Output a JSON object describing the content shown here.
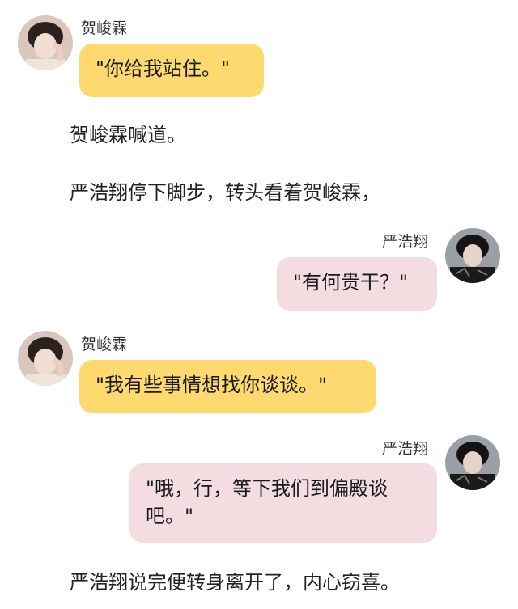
{
  "messages": [
    {
      "speaker": "贺峻霖",
      "text": "\"你给我站住。\""
    },
    {
      "speaker": "严浩翔",
      "text": "\"有何贵干？\""
    },
    {
      "speaker": "贺峻霖",
      "text": "\"我有些事情想找你谈谈。\""
    },
    {
      "speaker": "严浩翔",
      "text": "\"哦，行，等下我们到偏殿谈吧。\""
    }
  ],
  "narration": [
    "贺峻霖喊道。",
    "严浩翔停下脚步，转头看着贺峻霖，",
    "严浩翔说完便转身离开了，内心窃喜。"
  ],
  "colors": {
    "left_bubble": "#fdd96f",
    "right_bubble": "#f3dde0"
  },
  "icons": {
    "left_avatar": "avatar-portrait-light",
    "right_avatar": "avatar-portrait-dark"
  }
}
